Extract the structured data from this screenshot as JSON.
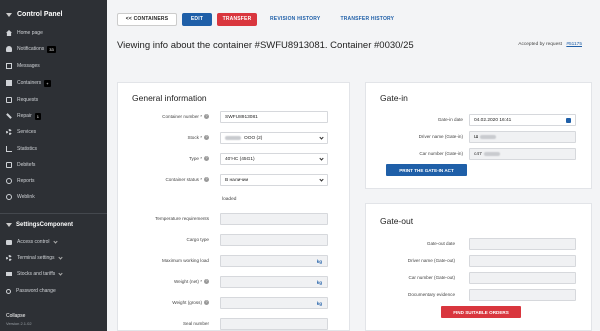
{
  "sidebar": {
    "title": "Control Panel",
    "items": [
      {
        "label": "Home page",
        "icon": "home-icon"
      },
      {
        "label": "Notifications",
        "icon": "bell-icon",
        "badge": "33"
      },
      {
        "label": "Messages",
        "icon": "mail-icon"
      },
      {
        "label": "Containers",
        "icon": "box-icon",
        "badge": "+"
      },
      {
        "label": "Requests",
        "icon": "edit-icon"
      },
      {
        "label": "Repair",
        "icon": "wrench-icon",
        "badge": "1"
      },
      {
        "label": "Services",
        "icon": "gear-icon"
      },
      {
        "label": "Statistics",
        "icon": "chart-icon"
      },
      {
        "label": "Debitefs",
        "icon": "doc-icon"
      },
      {
        "label": "Reports",
        "icon": "circle-icon"
      },
      {
        "label": "Weblink",
        "icon": "circle-icon"
      }
    ],
    "section_title": "SettingsComponent",
    "settings_items": [
      {
        "label": "Access control",
        "icon": "lock-icon"
      },
      {
        "label": "Terminal settings",
        "icon": "gear-icon"
      },
      {
        "label": "Stocks and tariffs",
        "icon": "truck-icon"
      },
      {
        "label": "Password change",
        "icon": "key-icon"
      }
    ],
    "collapse_label": "Collapse",
    "version": "Version 2.1.02"
  },
  "tabs": {
    "back": "<< CONTAINERS",
    "edit": "EDIT",
    "transfer": "TRANSFER",
    "revision": "REVISION HISTORY",
    "transfer_history": "TRANSFER HISTORY"
  },
  "page": {
    "title": "Viewing info about the container #SWFU8913081. Container #0030/25",
    "accepted_label": "Accepted by request",
    "accepted_link": "#51175"
  },
  "general": {
    "title": "General information",
    "fields": {
      "container_number": {
        "label": "Container number *",
        "value": "SWFU8913081"
      },
      "stock": {
        "label": "Stock *",
        "value": "OOO (2)"
      },
      "type": {
        "label": "Type *",
        "value": "40’HC (45G1)"
      },
      "status": {
        "label": "Container status *",
        "value": "В наличии"
      },
      "loaded": {
        "value": "loaded"
      },
      "temperature": {
        "label": "Temperature requirements"
      },
      "cargo_type": {
        "label": "Cargo type"
      },
      "max_load": {
        "label": "Maximum working load",
        "unit": "kg"
      },
      "weight_net": {
        "label": "Weight (net) *",
        "unit": "kg"
      },
      "weight_gross": {
        "label": "Weight (gross)",
        "unit": "kg"
      },
      "seal": {
        "label": "Seal number"
      }
    }
  },
  "gate_in": {
    "title": "Gate-in",
    "date": {
      "label": "Gate-in date",
      "value": "04.02.2020 16:41"
    },
    "driver": {
      "label": "Driver name (Gate-in)",
      "value": "Ш"
    },
    "car": {
      "label": "Car number (Gate-in)",
      "value": "c47"
    },
    "print_button": "PRINT THE GATE-IN ACT"
  },
  "gate_out": {
    "title": "Gate-out",
    "date": {
      "label": "Gate-out date"
    },
    "driver": {
      "label": "Driver name (Gate-out)"
    },
    "car": {
      "label": "Car number (Gate-out)"
    },
    "evidence": {
      "label": "Documentary evidence"
    },
    "find_button": "FIND SUITABLE ORDERS"
  },
  "colors": {
    "sidebar_bg": "#2d3035",
    "primary": "#1f5fa8",
    "danger": "#d9363e"
  }
}
